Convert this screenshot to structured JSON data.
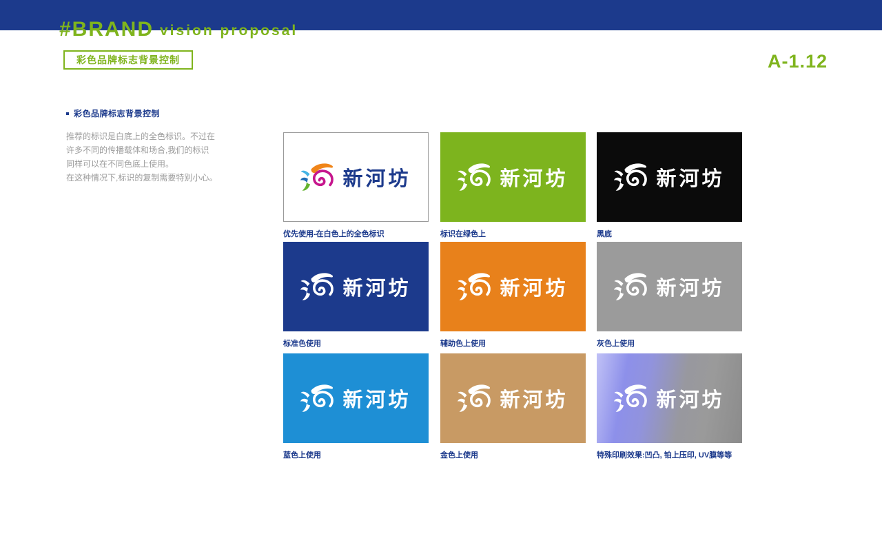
{
  "header": {
    "brand_tag": "#BRAND",
    "subtitle": "vision proposal",
    "page_title": "彩色品牌标志背景控制",
    "page_number": "A-1.12"
  },
  "sidebar": {
    "heading": "彩色品牌标志背景控制",
    "paragraph_lines": [
      "推荐的标识是白底上的全色标识。不过在",
      "许多不同的传播载体和场合,我们的标识",
      "同样可以在不同色底上使用。",
      "在这种情况下,标识的复制需要特别小心。"
    ]
  },
  "logo": {
    "wordmark": "新河坊"
  },
  "colors": {
    "green": "#7fb41d",
    "navy": "#1c3a8c",
    "gray_text": "#9b9b9b",
    "logo_magenta": "#c6168d",
    "logo_orange": "#f08519",
    "logo_lblue": "#45b4e4",
    "logo_blue": "#1f6cb5",
    "logo_green": "#63b32e"
  },
  "grid": {
    "cards": [
      {
        "label": "优先使用-在白色上的全色标识",
        "bg": "#ffffff",
        "variant": "color",
        "border": true
      },
      {
        "label": "标识在绿色上",
        "bg": "#7db41e",
        "variant": "white"
      },
      {
        "label": "黑底",
        "bg": "#0b0b0b",
        "variant": "white"
      },
      {
        "label": "标准色使用",
        "bg": "#1c3a8c",
        "variant": "white"
      },
      {
        "label": "辅助色上使用",
        "bg": "#e8811b",
        "variant": "white"
      },
      {
        "label": "灰色上使用",
        "bg": "#9b9b9b",
        "variant": "white"
      },
      {
        "label": "蓝色上使用",
        "bg": "#1e8fd5",
        "variant": "white"
      },
      {
        "label": "金色上使用",
        "bg": "#c89a64",
        "variant": "white"
      },
      {
        "label": "特殊印刷效果:凹凸, 铂上压印, UV膜等等",
        "bg": "linear-gradient(100deg, #c0c1f6 0%, #8d90ea 20%, #9193dd 35%, #98989f 58%, #9a9a9a 75%, #8b8b8b 100%)",
        "variant": "white"
      }
    ]
  }
}
